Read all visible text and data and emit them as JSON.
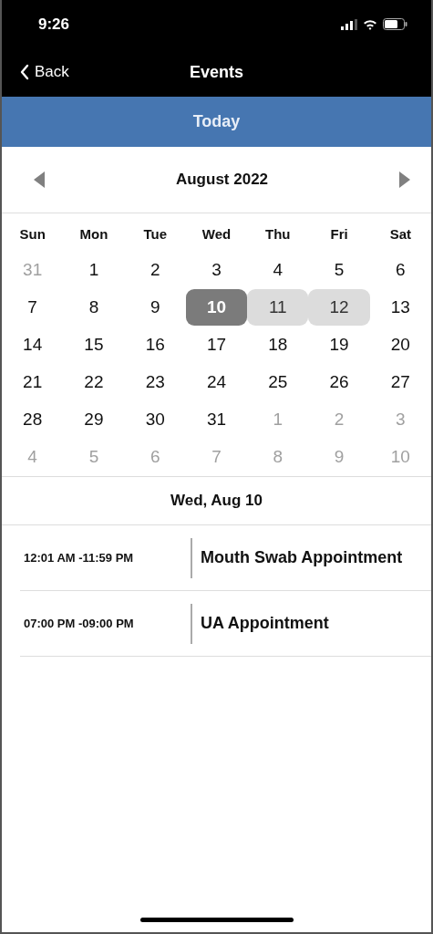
{
  "status_bar": {
    "time": "9:26"
  },
  "nav": {
    "back": "Back",
    "title": "Events"
  },
  "today_button": "Today",
  "calendar": {
    "month": "August 2022",
    "weekdays": [
      "Sun",
      "Mon",
      "Tue",
      "Wed",
      "Thu",
      "Fri",
      "Sat"
    ],
    "days": [
      {
        "label": "31",
        "muted": true,
        "selected": false,
        "highlighted": false
      },
      {
        "label": "1",
        "muted": false,
        "selected": false,
        "highlighted": false
      },
      {
        "label": "2",
        "muted": false,
        "selected": false,
        "highlighted": false
      },
      {
        "label": "3",
        "muted": false,
        "selected": false,
        "highlighted": false
      },
      {
        "label": "4",
        "muted": false,
        "selected": false,
        "highlighted": false
      },
      {
        "label": "5",
        "muted": false,
        "selected": false,
        "highlighted": false
      },
      {
        "label": "6",
        "muted": false,
        "selected": false,
        "highlighted": false
      },
      {
        "label": "7",
        "muted": false,
        "selected": false,
        "highlighted": false
      },
      {
        "label": "8",
        "muted": false,
        "selected": false,
        "highlighted": false
      },
      {
        "label": "9",
        "muted": false,
        "selected": false,
        "highlighted": false
      },
      {
        "label": "10",
        "muted": false,
        "selected": true,
        "highlighted": false
      },
      {
        "label": "11",
        "muted": false,
        "selected": false,
        "highlighted": true
      },
      {
        "label": "12",
        "muted": false,
        "selected": false,
        "highlighted": true
      },
      {
        "label": "13",
        "muted": false,
        "selected": false,
        "highlighted": false
      },
      {
        "label": "14",
        "muted": false,
        "selected": false,
        "highlighted": false
      },
      {
        "label": "15",
        "muted": false,
        "selected": false,
        "highlighted": false
      },
      {
        "label": "16",
        "muted": false,
        "selected": false,
        "highlighted": false
      },
      {
        "label": "17",
        "muted": false,
        "selected": false,
        "highlighted": false
      },
      {
        "label": "18",
        "muted": false,
        "selected": false,
        "highlighted": false
      },
      {
        "label": "19",
        "muted": false,
        "selected": false,
        "highlighted": false
      },
      {
        "label": "20",
        "muted": false,
        "selected": false,
        "highlighted": false
      },
      {
        "label": "21",
        "muted": false,
        "selected": false,
        "highlighted": false
      },
      {
        "label": "22",
        "muted": false,
        "selected": false,
        "highlighted": false
      },
      {
        "label": "23",
        "muted": false,
        "selected": false,
        "highlighted": false
      },
      {
        "label": "24",
        "muted": false,
        "selected": false,
        "highlighted": false
      },
      {
        "label": "25",
        "muted": false,
        "selected": false,
        "highlighted": false
      },
      {
        "label": "26",
        "muted": false,
        "selected": false,
        "highlighted": false
      },
      {
        "label": "27",
        "muted": false,
        "selected": false,
        "highlighted": false
      },
      {
        "label": "28",
        "muted": false,
        "selected": false,
        "highlighted": false
      },
      {
        "label": "29",
        "muted": false,
        "selected": false,
        "highlighted": false
      },
      {
        "label": "30",
        "muted": false,
        "selected": false,
        "highlighted": false
      },
      {
        "label": "31",
        "muted": false,
        "selected": false,
        "highlighted": false
      },
      {
        "label": "1",
        "muted": true,
        "selected": false,
        "highlighted": false
      },
      {
        "label": "2",
        "muted": true,
        "selected": false,
        "highlighted": false
      },
      {
        "label": "3",
        "muted": true,
        "selected": false,
        "highlighted": false
      },
      {
        "label": "4",
        "muted": true,
        "selected": false,
        "highlighted": false
      },
      {
        "label": "5",
        "muted": true,
        "selected": false,
        "highlighted": false
      },
      {
        "label": "6",
        "muted": true,
        "selected": false,
        "highlighted": false
      },
      {
        "label": "7",
        "muted": true,
        "selected": false,
        "highlighted": false
      },
      {
        "label": "8",
        "muted": true,
        "selected": false,
        "highlighted": false
      },
      {
        "label": "9",
        "muted": true,
        "selected": false,
        "highlighted": false
      },
      {
        "label": "10",
        "muted": true,
        "selected": false,
        "highlighted": false
      }
    ]
  },
  "selected_date": "Wed, Aug 10",
  "events": [
    {
      "time": "12:01 AM -11:59 PM",
      "title": "Mouth Swab Appointment"
    },
    {
      "time": "07:00 PM -09:00 PM",
      "title": "UA Appointment"
    }
  ]
}
